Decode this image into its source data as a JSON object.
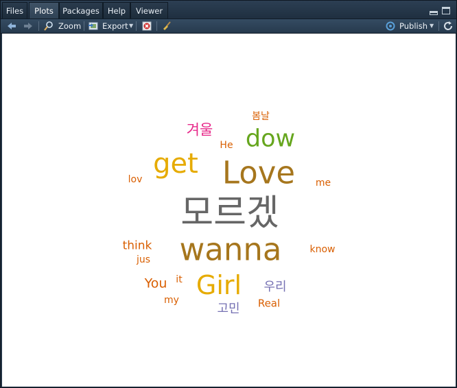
{
  "tabs": [
    {
      "label": "Files",
      "active": false
    },
    {
      "label": "Plots",
      "active": true
    },
    {
      "label": "Packages",
      "active": false
    },
    {
      "label": "Help",
      "active": false
    },
    {
      "label": "Viewer",
      "active": false
    }
  ],
  "toolbar": {
    "zoom_label": "Zoom",
    "export_label": "Export",
    "publish_label": "Publish"
  },
  "colors": {
    "dark_gray": "#666666",
    "brown": "#A6761D",
    "gold": "#E6AB02",
    "green": "#66A61E",
    "magenta": "#E7298A",
    "orange": "#D95F02",
    "purple": "#7570B3"
  },
  "wordcloud": {
    "words": [
      {
        "text": "모르겠",
        "color": "#666666"
      },
      {
        "text": "wanna",
        "color": "#A6761D"
      },
      {
        "text": "Love",
        "color": "#A6761D"
      },
      {
        "text": "get",
        "color": "#E6AB02"
      },
      {
        "text": "Girl",
        "color": "#E6AB02"
      },
      {
        "text": "dow",
        "color": "#66A61E"
      },
      {
        "text": "겨울",
        "color": "#E7298A"
      },
      {
        "text": "봄날",
        "color": "#D95F02"
      },
      {
        "text": "He",
        "color": "#D95F02"
      },
      {
        "text": "lov",
        "color": "#D95F02"
      },
      {
        "text": "me",
        "color": "#D95F02"
      },
      {
        "text": "think",
        "color": "#D95F02"
      },
      {
        "text": "jus",
        "color": "#D95F02"
      },
      {
        "text": "know",
        "color": "#D95F02"
      },
      {
        "text": "You",
        "color": "#D95F02"
      },
      {
        "text": "it",
        "color": "#D95F02"
      },
      {
        "text": "my",
        "color": "#D95F02"
      },
      {
        "text": "우리",
        "color": "#7570B3"
      },
      {
        "text": "고민",
        "color": "#7570B3"
      },
      {
        "text": "Real",
        "color": "#D95F02"
      }
    ]
  }
}
